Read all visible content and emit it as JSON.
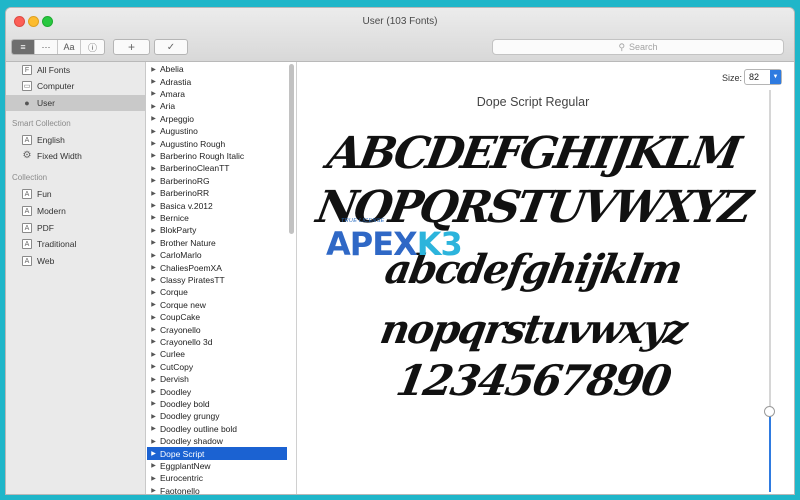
{
  "window": {
    "title": "User (103 Fonts)"
  },
  "toolbar": {
    "view_buttons": [
      "≡",
      "⋯",
      "Aa",
      "ⓘ"
    ],
    "add_button": "+",
    "check_button": "✓"
  },
  "search": {
    "placeholder": "Search"
  },
  "sidebar": {
    "libraries": [
      {
        "label": "All Fonts",
        "icon": "F"
      },
      {
        "label": "Computer",
        "icon": "▭"
      },
      {
        "label": "User",
        "icon": "●"
      }
    ],
    "smart_collection_heading": "Smart Collection",
    "smart_collections": [
      {
        "label": "English",
        "icon": "A"
      },
      {
        "label": "Fixed Width",
        "icon": "⚙"
      }
    ],
    "collection_heading": "Collection",
    "collections": [
      {
        "label": "Fun",
        "icon": "A"
      },
      {
        "label": "Modern",
        "icon": "A"
      },
      {
        "label": "PDF",
        "icon": "A"
      },
      {
        "label": "Traditional",
        "icon": "A"
      },
      {
        "label": "Web",
        "icon": "A"
      }
    ]
  },
  "font_list": {
    "items": [
      "Abelia",
      "Adrastia",
      "Amara",
      "Aria",
      "Arpeggio",
      "Augustino",
      "Augustino Rough",
      "Barberino Rough Italic",
      "BarberinoCleanTT",
      "BarberinoRG",
      "BarberinoRR",
      "Basica v.2012",
      "Bernice",
      "BlokParty",
      "Brother Nature",
      "CarloMarlo",
      "ChaliesPoemXA",
      "Classy PiratesTT",
      "Corque",
      "Corque new",
      "CoupCake",
      "Crayonello",
      "Crayonello 3d",
      "Curlee",
      "CutCopy",
      "Dervish",
      "Doodley",
      "Doodley bold",
      "Doodley grungy",
      "Doodley outline bold",
      "Doodley shadow",
      "Dope Script",
      "EggplantNew",
      "Eurocentric",
      "Faotonello"
    ],
    "selected": "Dope Script"
  },
  "preview": {
    "font_name": "Dope Script Regular",
    "size_label": "Size:",
    "size_value": "82",
    "size_level_fraction": 0.8,
    "sample_lines": [
      "ABCDEFGHIJKLM",
      "NOPQRSTUVWXYZ",
      "abcdefghijklm",
      "nopqrstuvwxyz",
      "1234567890"
    ]
  },
  "watermark": {
    "small": "TRUE LICENSE",
    "part1": "APEX",
    "part2": "K3"
  }
}
